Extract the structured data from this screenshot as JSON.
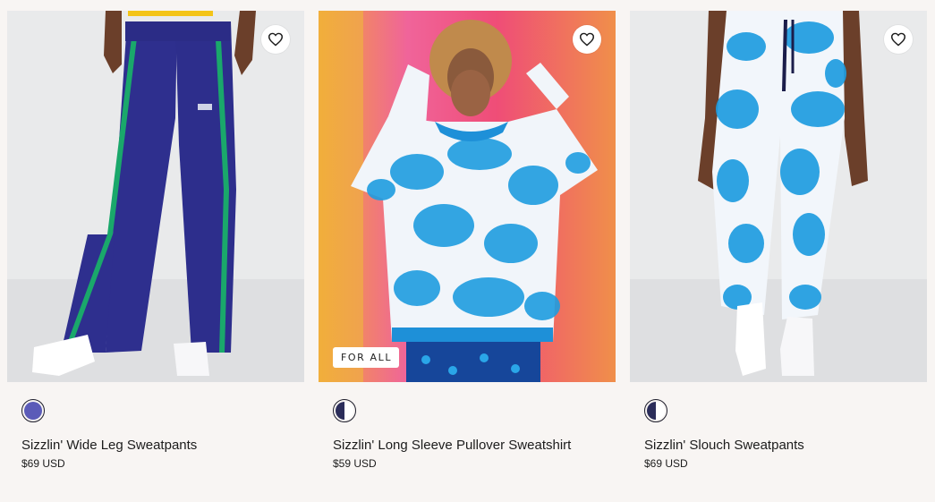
{
  "products": [
    {
      "title": "Sizzlin' Wide Leg Sweatpants",
      "price": "$69 USD",
      "image_icon": "product-image-wide-leg-sweatpants",
      "swatches": [
        {
          "left": "#5b5bb8",
          "right": "#5b5bb8"
        }
      ]
    },
    {
      "title": "Sizzlin' Long Sleeve Pullover Sweatshirt",
      "price": "$59 USD",
      "badge": "FOR ALL",
      "image_icon": "product-image-pullover-sweatshirt",
      "swatches": [
        {
          "left": "#2b2d5a",
          "right": "#ffffff"
        }
      ]
    },
    {
      "title": "Sizzlin' Slouch Sweatpants",
      "price": "$69 USD",
      "image_icon": "product-image-slouch-sweatpants",
      "swatches": [
        {
          "left": "#2b2d5a",
          "right": "#ffffff"
        }
      ]
    }
  ],
  "colors": {
    "page_background": "#f8f5f3",
    "text": "#1c1c1c",
    "navy": "#2e2f8e",
    "stripe_green": "#1aa86b",
    "tie_dye_blue": "#1f9de0"
  }
}
